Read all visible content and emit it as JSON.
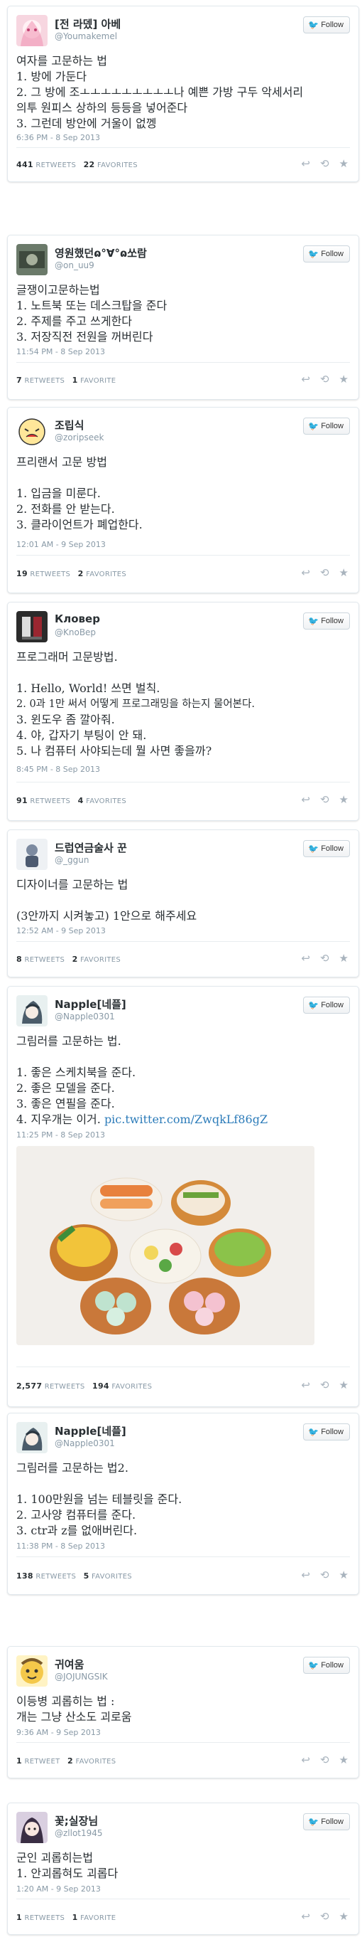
{
  "follow_label": "Follow",
  "stats_labels": {
    "retweets": "RETWEETS",
    "favorites": "FAVORITES",
    "retweet": "RETWEET",
    "favorite": "FAVORITE"
  },
  "tweets": [
    {
      "name": "[전 라뎄] 아베",
      "handle": "@Youmakemel",
      "lines": [
        "여자를 고문하는 법",
        "1. 방에 가둔다",
        "2. 그 방에 조ㅗㅗㅗㅗㅗㅗㅗㅗㅗ나 예쁜 가방 구두 악세서리",
        "의투 원피스 상하의 등등을 넣어준다",
        "3. 그런데 방안에 거울이 없껭"
      ],
      "time": "6:36 PM - 8 Sep 2013",
      "retweets": "441",
      "favorites": "22"
    },
    {
      "name": "영원했던ɷ°∀°ɷ쏘람",
      "handle": "@on_uu9",
      "lines": [
        "글쟁이고문하는법",
        "1. 노트북 또는 데스크탑을 준다",
        "2. 주제를 주고 쓰게한다",
        "3. 저장직전 전원을 꺼버린다"
      ],
      "time": "11:54 PM - 8 Sep 2013",
      "retweets": "7",
      "favorites": "1"
    },
    {
      "name": "조립식",
      "handle": "@zoripseek",
      "lines": [
        "프리랜서 고문 방법",
        "",
        "1. 입금을 미룬다.",
        "2. 전화를 안 받는다.",
        "3. 클라이언트가 폐업한다."
      ],
      "time": "12:01 AM - 9 Sep 2013",
      "retweets": "19",
      "favorites": "2"
    },
    {
      "name": "Кловер",
      "handle": "@KnoBep",
      "lines": [
        "프로그래머 고문방법.",
        "",
        "1. Hello, World! 쓰면 벌칙.",
        "2. 0과 1만 써서 어떻게 프로그래밍을 하는지 물어본다.",
        "3. 윈도우 좀 깔아줘.",
        "4. 야, 갑자기 부팅이 안 돼.",
        "5. 나 컴퓨터 사야되는데 뭘 사면 좋을까?"
      ],
      "time": "8:45 PM - 8 Sep 2013",
      "retweets": "91",
      "favorites": "4"
    },
    {
      "name": "드럽연금술사 꾼",
      "handle": "@_ggun",
      "lines": [
        "디자이너를 고문하는 법",
        "",
        "(3안까지 시켜놓고) 1안으로 해주세요"
      ],
      "time": "12:52 AM - 9 Sep 2013",
      "retweets": "8",
      "favorites": "2"
    },
    {
      "name": "Napple[네플]",
      "handle": "@Napple0301",
      "lines": [
        "그림러를 고문하는 법.",
        "",
        "1. 좋은 스케치북을 준다.",
        "2. 좋은 모델을 준다.",
        "3. 좋은 연필을 준다."
      ],
      "line4_prefix": "4. 지우개는 이거.",
      "line4_link": "pic.twitter.com/ZwqkLf86gZ",
      "time": "11:25 PM - 8 Sep 2013",
      "retweets": "2,577",
      "favorites": "194"
    },
    {
      "name": "Napple[네플]",
      "handle": "@Napple0301",
      "lines": [
        "그림러를 고문하는 법2.",
        "",
        "1. 100만원을 넘는 테블릿을 준다.",
        "2. 고사양 컴퓨터를 준다.",
        "3. ctr과 z를 없애버린다."
      ],
      "time": "11:38 PM - 8 Sep 2013",
      "retweets": "138",
      "favorites": "5"
    },
    {
      "name": "귀여움",
      "handle": "@JOJUNGSIK",
      "lines": [
        "이등병 괴롭히는 법 :",
        "개는 그냥 산소도 괴로움"
      ],
      "time": "9:36 AM - 9 Sep 2013",
      "retweets": "1",
      "favorites": "2"
    },
    {
      "name": "꽃;실장님",
      "handle": "@zllot1945",
      "lines": [
        "군인 괴롭히는법",
        "1. 안괴롭혀도 괴롭다"
      ],
      "time": "1:20 AM - 9 Sep 2013",
      "retweets": "1",
      "favorites": "1"
    }
  ],
  "icons": {
    "reply": "reply-icon",
    "retweet": "retweet-icon",
    "favorite": "star-icon",
    "twitter": "twitter-bird-icon"
  }
}
